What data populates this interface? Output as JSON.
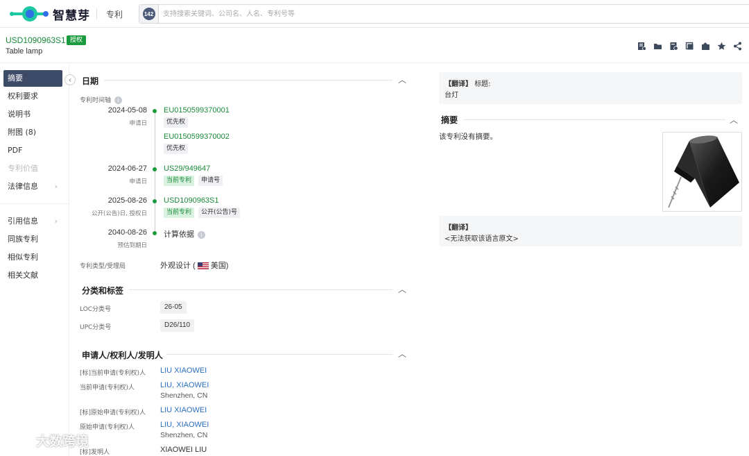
{
  "app": {
    "logo_text": "智慧芽",
    "nav_label": "专利",
    "search": {
      "badge": "142",
      "placeholder": "支持搜索关键词、公司名、人名、专利号等"
    }
  },
  "patent": {
    "number": "USD1090963S1",
    "status": "授权",
    "title": "Table lamp"
  },
  "header_actions": [
    "add-note-icon",
    "folder-icon",
    "pdf-icon",
    "copy-icon",
    "export-icon",
    "star-icon",
    "share-icon"
  ],
  "sidebar": {
    "items": [
      {
        "label": "摘要"
      },
      {
        "label": "权利要求"
      },
      {
        "label": "说明书"
      },
      {
        "label": "附图 (8)"
      },
      {
        "label": "PDF"
      },
      {
        "label": "专利价值"
      },
      {
        "label": "法律信息"
      },
      {
        "label": "引用信息"
      },
      {
        "label": "同族专利"
      },
      {
        "label": "相似专利"
      },
      {
        "label": "相关文献"
      }
    ]
  },
  "dates": {
    "heading": "日期",
    "timeline_label": "专利时间轴",
    "events": [
      {
        "date": "2024-05-08",
        "sub": "申请日",
        "entries": [
          {
            "number": "EU0150599370001",
            "tags": [
              "优先权"
            ]
          },
          {
            "number": "EU0150599370002",
            "tags": [
              "优先权"
            ]
          }
        ]
      },
      {
        "date": "2024-06-27",
        "sub": "申请日",
        "entries": [
          {
            "number": "US29/949647",
            "tags": [
              "当前专利",
              "申请号"
            ]
          }
        ]
      },
      {
        "date": "2025-08-26",
        "sub": "公开(公告)日, 授权日",
        "entries": [
          {
            "number": "USD1090963S1",
            "tags": [
              "当前专利",
              "公开(公告)号"
            ]
          }
        ]
      },
      {
        "date": "2040-08-26",
        "sub": "预估到期日",
        "entries": [
          {
            "number": "计算依据",
            "tags": []
          }
        ]
      }
    ],
    "type_label": "专利类型/受理局",
    "type_value": "外观设计 (",
    "country": "美国",
    "type_close": ")"
  },
  "classification": {
    "heading": "分类和标签",
    "loc_label": "LOC分类号",
    "loc_value": "26-05",
    "upc_label": "UPC分类号",
    "upc_value": "D26/110"
  },
  "parties": {
    "heading": "申请人/权利人/发明人",
    "rows": [
      {
        "label": "[标]当前申请(专利权)人",
        "name": "LIU XIAOWEI",
        "address": ""
      },
      {
        "label": "当前申请(专利权)人",
        "name": "LIU, XIAOWEI",
        "address": "Shenzhen, CN"
      },
      {
        "label": "[标]原始申请(专利权)人",
        "name": "LIU XIAOWEI",
        "address": ""
      },
      {
        "label": "原始申请(专利权)人",
        "name": "LIU, XIAOWEI",
        "address": "Shenzhen, CN"
      },
      {
        "label": "[标]发明人",
        "name": "XIAOWEI LIU",
        "address": ""
      }
    ]
  },
  "right": {
    "translate_tag": "【翻译】",
    "title_label": "标题:",
    "title_cn": "台灯",
    "abstract_heading": "摘要",
    "abstract_text": "该专利没有摘要。",
    "translate2_tag": "【翻译】",
    "translate2_text": "<无法获取该语言原文>"
  },
  "watermark": "大数跨境",
  "colors": {
    "brand_green": "#1a9c3e",
    "link_blue": "#2a6fbf",
    "sidebar_active": "#3d4a68"
  }
}
